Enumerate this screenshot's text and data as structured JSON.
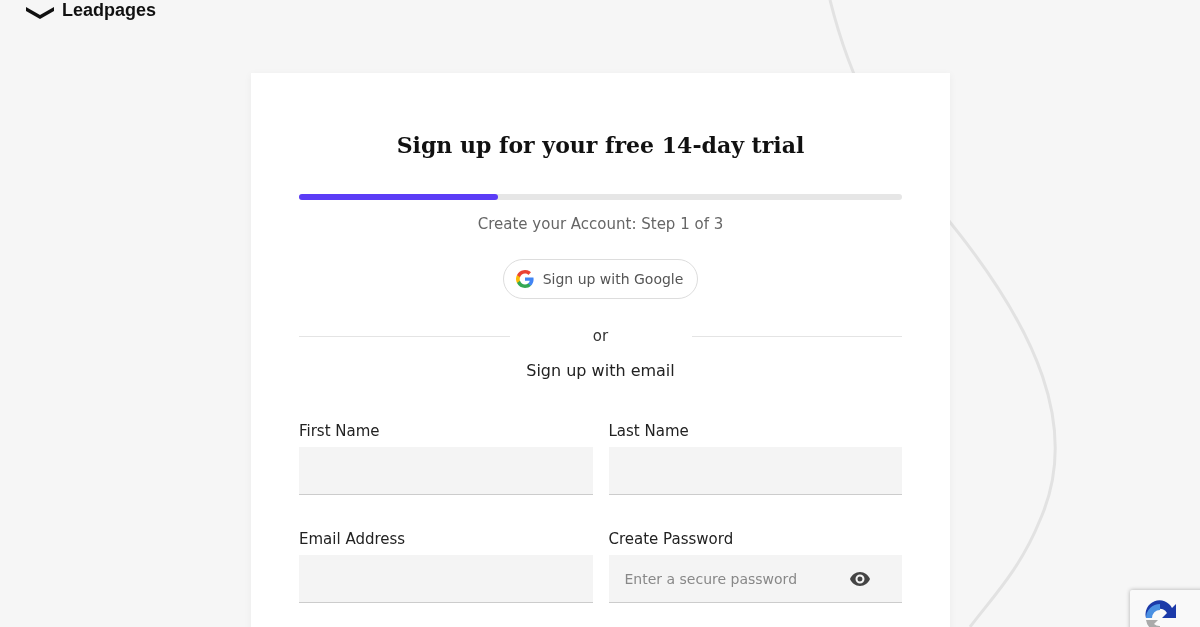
{
  "logo": {
    "text": "Leadpages"
  },
  "card": {
    "title": "Sign up for your free 14-day trial",
    "progress": {
      "level": 0.33,
      "caption": "Create your Account: Step 1 of 3"
    },
    "google_button": "Sign up with Google",
    "divider": "or",
    "email_heading": "Sign up with email",
    "fields": [
      {
        "label": "First Name",
        "kind": "text"
      },
      {
        "label": "Last Name",
        "kind": "text"
      },
      {
        "label": "Email Address",
        "kind": "text"
      },
      {
        "label": "Create Password",
        "placeholder": "Enter a secure password",
        "kind": "password"
      }
    ]
  }
}
